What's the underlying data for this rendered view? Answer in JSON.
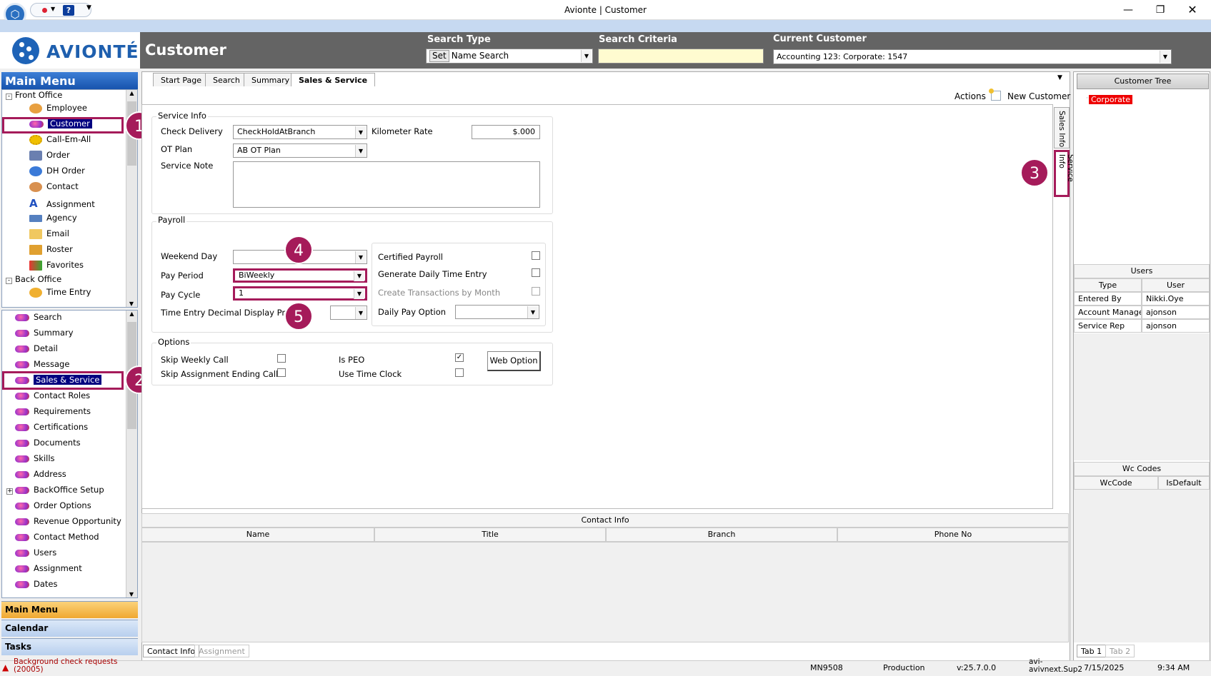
{
  "window": {
    "title": "Avionte | Customer"
  },
  "brand": {
    "name": "AVIONTÉ"
  },
  "header": {
    "page_title": "Customer",
    "search_type_label": "Search Type",
    "set_label": "Set",
    "search_type_value": "Name Search",
    "search_criteria_label": "Search Criteria",
    "current_customer_label": "Current Customer",
    "current_customer_value": "Accounting 123: Corporate: 1547"
  },
  "main_menu": {
    "title": "Main Menu",
    "front_office": {
      "label": "Front Office",
      "items": [
        "Employee",
        "Customer",
        "Call-Em-All",
        "Order",
        "DH Order",
        "Contact",
        "Assignment",
        "Agency",
        "Email",
        "Roster",
        "Favorites"
      ]
    },
    "back_office": {
      "label": "Back Office",
      "items": [
        "Time Entry"
      ]
    },
    "sub_items": [
      "Search",
      "Summary",
      "Detail",
      "Message",
      "Sales & Service",
      "Contact Roles",
      "Requirements",
      "Certifications",
      "Documents",
      "Skills",
      "Address",
      "BackOffice Setup",
      "Order Options",
      "Revenue Opportunity",
      "Contact Method",
      "Users",
      "Assignment",
      "Dates"
    ],
    "bottom_buttons": [
      "Main Menu",
      "Calendar",
      "Tasks"
    ]
  },
  "tabs": [
    "Start Page",
    "Search",
    "Summary",
    "Sales & Service"
  ],
  "toolbar": {
    "actions": "Actions",
    "new_customer": "New Customer"
  },
  "side_tabs": {
    "sales_info": "Sales Info",
    "service_info": "Service Info"
  },
  "service_info": {
    "title": "Service Info",
    "check_delivery_label": "Check Delivery",
    "check_delivery_value": "CheckHoldAtBranch",
    "kilometer_rate_label": "Kilometer Rate",
    "kilometer_rate_value": "$.000",
    "ot_plan_label": "OT Plan",
    "ot_plan_value": "AB OT Plan",
    "service_note_label": "Service Note"
  },
  "payroll": {
    "title": "Payroll",
    "weekend_day_label": "Weekend Day",
    "pay_period_label": "Pay Period",
    "pay_period_value": "BiWeekly",
    "pay_cycle_label": "Pay Cycle",
    "pay_cycle_value": "1",
    "time_entry_decimal_label": "Time Entry Decimal Display Precisi",
    "certified_payroll_label": "Certified Payroll",
    "generate_daily_label": "Generate Daily Time Entry",
    "create_transactions_label": "Create Transactions by Month",
    "daily_pay_option_label": "Daily Pay Option"
  },
  "options": {
    "title": "Options",
    "skip_weekly_call": "Skip Weekly Call",
    "skip_assignment_ending_call": "Skip Assignment Ending Call",
    "is_peo": "Is PEO",
    "use_time_clock": "Use Time Clock",
    "web_option": "Web Option"
  },
  "contact_info": {
    "title": "Contact Info",
    "columns": [
      "Name",
      "Title",
      "Branch",
      "Phone No"
    ],
    "bottom_tabs": [
      "Contact Info",
      "Assignment"
    ]
  },
  "right_panel": {
    "customer_tree_button": "Customer Tree",
    "tree_node": "Corporate",
    "users_title": "Users",
    "users_columns": [
      "Type",
      "User"
    ],
    "users_rows": [
      [
        "Entered By",
        "Nikki.Oye"
      ],
      [
        "Account Manage",
        "ajonson"
      ],
      [
        "Service Rep",
        "ajonson"
      ]
    ],
    "wc_title": "Wc Codes",
    "wc_columns": [
      "WcCode",
      "IsDefault"
    ],
    "bottom_tabs": [
      "Tab 1",
      "Tab 2"
    ]
  },
  "annotations": [
    "1",
    "2",
    "3",
    "4",
    "5"
  ],
  "status_bar": {
    "alert_line1": "Background check requests",
    "alert_line2": "(20005)",
    "machine": "MN9508",
    "environment": "Production",
    "version": "v:25.7.0.0",
    "server_line1": "avi-",
    "server_line2": "avivnext.Sup2",
    "date": "7/15/2025",
    "time": "9:34 AM"
  },
  "colors": {
    "accent": "#a51b5a",
    "header": "#646464",
    "brand": "#1e63b7",
    "tree_node": "#ff0000"
  }
}
